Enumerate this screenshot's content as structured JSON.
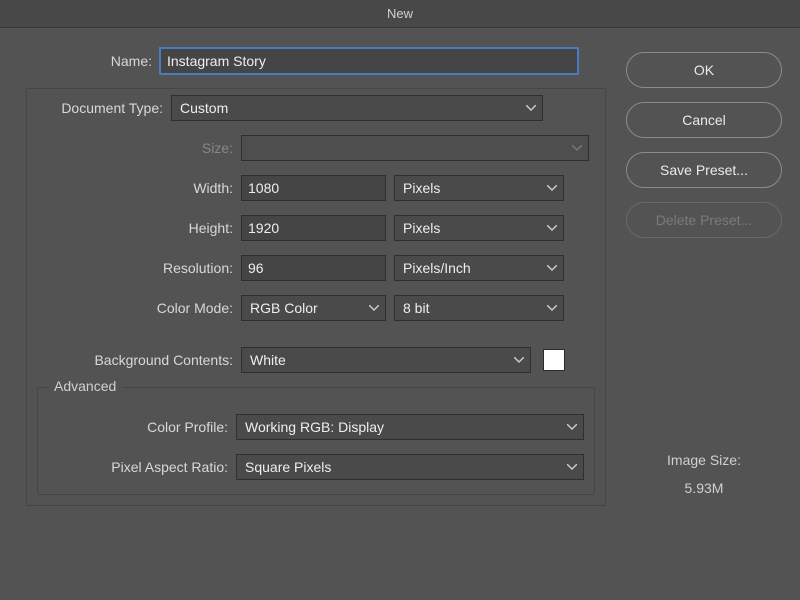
{
  "title": "New",
  "labels": {
    "name": "Name:",
    "document_type": "Document Type:",
    "size": "Size:",
    "width": "Width:",
    "height": "Height:",
    "resolution": "Resolution:",
    "color_mode": "Color Mode:",
    "background_contents": "Background Contents:",
    "advanced": "Advanced",
    "color_profile": "Color Profile:",
    "pixel_aspect_ratio": "Pixel Aspect Ratio:",
    "image_size": "Image Size:"
  },
  "values": {
    "name": "Instagram Story",
    "document_type": "Custom",
    "size": "",
    "width": "1080",
    "width_unit": "Pixels",
    "height": "1920",
    "height_unit": "Pixels",
    "resolution": "96",
    "resolution_unit": "Pixels/Inch",
    "color_mode": "RGB Color",
    "bit_depth": "8 bit",
    "background_contents": "White",
    "background_color": "#ffffff",
    "color_profile": "Working RGB:  Display",
    "pixel_aspect_ratio": "Square Pixels",
    "image_size": "5.93M"
  },
  "buttons": {
    "ok": "OK",
    "cancel": "Cancel",
    "save_preset": "Save Preset...",
    "delete_preset": "Delete Preset..."
  }
}
